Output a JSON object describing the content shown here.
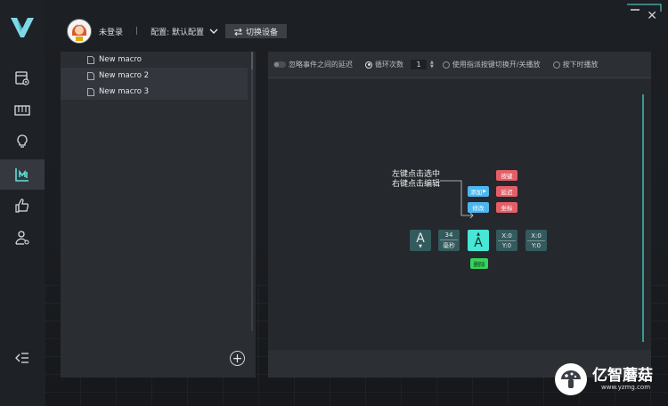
{
  "header": {
    "login_status": "未登录",
    "separator": "|",
    "config_label": "配置: 默认配置",
    "switch_device_label": "切换设备"
  },
  "sidebar": {
    "items": [
      {
        "name": "device-settings",
        "icon": "device-gear-icon",
        "active": false
      },
      {
        "name": "keyboard",
        "icon": "keyboard-icon",
        "active": false
      },
      {
        "name": "lighting",
        "icon": "bulb-icon",
        "active": false
      },
      {
        "name": "macro",
        "icon": "macro-icon",
        "active": true
      },
      {
        "name": "recommend",
        "icon": "thumbs-up-icon",
        "active": false
      },
      {
        "name": "account",
        "icon": "user-settings-icon",
        "active": false
      }
    ]
  },
  "macro_list": {
    "items": [
      {
        "label": "New macro"
      },
      {
        "label": "New macro 2"
      },
      {
        "label": "New macro 3"
      }
    ]
  },
  "toolbar": {
    "ignore_delay_label": "忽略事件之间的延迟",
    "loop_count_label": "循环次数",
    "loop_count_value": "1",
    "toggle_play_label": "使用指派按键切换开/关播放",
    "press_play_label": "按下时播放"
  },
  "editor": {
    "hint_line1": "左键点击选中",
    "hint_line2": "右键点击编辑",
    "add_label": "添加",
    "modify_label": "修改",
    "key_tag": "按键",
    "delay_tag": "延迟",
    "mouse_tag": "坐标",
    "delete_label": "删除",
    "blocks": {
      "key1_letter": "A",
      "key1_arrow": "▼",
      "delay_value": "34",
      "delay_unit": "毫秒",
      "key2_arrow": "▲",
      "key2_letter": "A",
      "coord1_x": "X:0",
      "coord1_y": "Y:0",
      "coord2_x": "X:0",
      "coord2_y": "Y:0"
    }
  },
  "watermark": {
    "brand": "亿智蘑菇",
    "url": "www.yzmg.com"
  },
  "colors": {
    "accent_teal": "#48e6d6",
    "tag_red": "#e35f68",
    "tag_blue": "#4db6f0",
    "tag_green": "#36d35e"
  }
}
